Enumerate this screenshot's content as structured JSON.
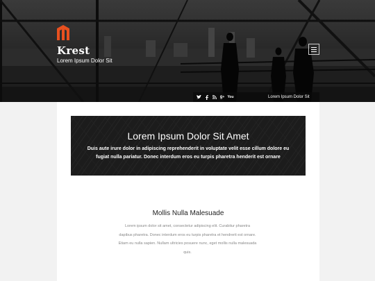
{
  "header": {
    "site_title": "Krest",
    "tagline": "Lorem Ipsum Dolor Sit",
    "menu_icon": "hamburger-icon",
    "logo_icon": "krest-logo-icon"
  },
  "social_bar": {
    "icons": [
      "twitter-icon",
      "facebook-icon",
      "rss-icon",
      "googleplus-icon",
      "youtube-icon"
    ],
    "label": "Lorem Ipsum Dolor Sit"
  },
  "banner": {
    "title": "Lorem Ipsum Dolor Sit Amet",
    "text": "Duis aute irure dolor in adipiscing reprehenderit in voluptate velit esse cillum dolore eu fugiat nulla pariatur. Donec interdum eros eu turpis pharetra henderit est ornare"
  },
  "section": {
    "title": "Mollis Nulla Malesuade",
    "text": "Lorem ipsum dolor sit amet, consectetur adipiscing elit. Curabitur pharetra dapibus pharetra. Donec interdum eros eu turpis pharetra et hendrerit est ornare. Etiam eu nulla sapien. Nullam ultricies posuere nunc, eget mollis nulla malesuada quis."
  },
  "colors": {
    "accent": "#e8501f",
    "banner_bg": "#1c1c1c",
    "page_bg": "#f2f2f2"
  }
}
